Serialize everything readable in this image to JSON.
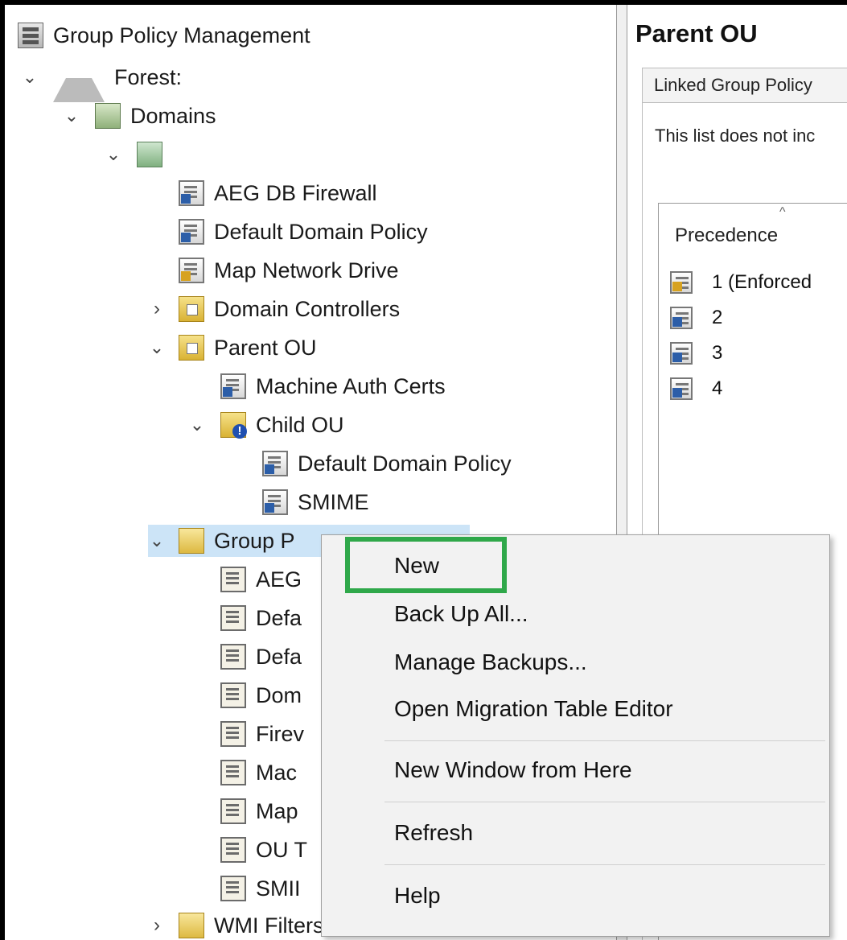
{
  "tree": {
    "root_label": "Group Policy Management",
    "forest_label": "Forest:",
    "domains_label": "Domains",
    "domain_label": "",
    "domain_links": [
      "AEG DB Firewall",
      "Default Domain Policy",
      "Map Network Drive"
    ],
    "domain_controllers_label": "Domain Controllers",
    "parent_ou_label": "Parent OU",
    "parent_ou_links": [
      "Machine Auth Certs"
    ],
    "child_ou_label": "Child OU",
    "child_ou_links": [
      "Default Domain Policy",
      "SMIME"
    ],
    "gpo_folder_label": "Group P",
    "gpo_items": [
      "AEG",
      "Defa",
      "Defa",
      "Dom",
      "Firev",
      "Mac",
      "Map",
      "OU T",
      "SMII"
    ],
    "wmi_filters_label": "WMI Filters"
  },
  "right_pane": {
    "title": "Parent OU",
    "tab_label": "Linked Group Policy",
    "note": "This list does not inc",
    "column_header": "Precedence",
    "rows": [
      "1  (Enforced",
      "2",
      "3",
      "4"
    ]
  },
  "context_menu": {
    "items": [
      "New",
      "Back Up All...",
      "Manage Backups...",
      "Open Migration Table Editor",
      "New Window from Here",
      "Refresh",
      "Help"
    ]
  },
  "colors": {
    "highlight": "#2fa84a",
    "selection": "#cce4f7"
  }
}
